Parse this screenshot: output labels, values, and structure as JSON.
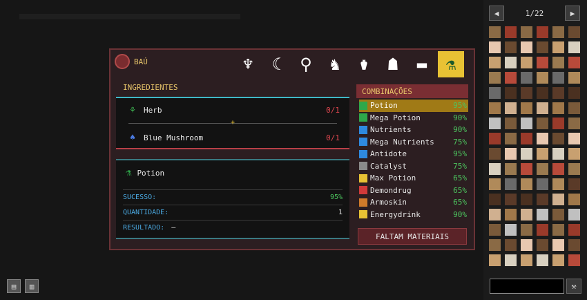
{
  "window": {
    "title": "BAÚ",
    "tabs": [
      "claws-icon",
      "crescent-icon",
      "totem-icon",
      "creature-icon",
      "lamp-icon",
      "face-icon",
      "anvil-icon",
      "potion-icon"
    ],
    "active_tab": 7
  },
  "ingredients": {
    "label": "INGREDIENTES",
    "plus": "+",
    "items": [
      {
        "name": "Herb",
        "qty": "0/1",
        "icon": "herb-icon"
      },
      {
        "name": "Blue Mushroom",
        "qty": "0/1",
        "icon": "mushroom-icon"
      }
    ]
  },
  "result": {
    "name": "Potion",
    "icon": "potion-icon",
    "rows": [
      {
        "key": "SUCESSO:",
        "value": "95%"
      },
      {
        "key": "QUANTIDADE:",
        "value": "1"
      },
      {
        "key": "RESULTADO:",
        "value": "—"
      }
    ]
  },
  "combos": {
    "label": "COMBINAÇÕES",
    "selected": 0,
    "items": [
      {
        "name": "Potion",
        "pct": "95%",
        "color": "#2ea84a"
      },
      {
        "name": "Mega Potion",
        "pct": "90%",
        "color": "#2ea84a"
      },
      {
        "name": "Nutrients",
        "pct": "90%",
        "color": "#2e8ae0"
      },
      {
        "name": "Mega Nutrients",
        "pct": "75%",
        "color": "#2e8ae0"
      },
      {
        "name": "Antidote",
        "pct": "95%",
        "color": "#2e8ae0"
      },
      {
        "name": "Catalyst",
        "pct": "75%",
        "color": "#8a8a8a"
      },
      {
        "name": "Max Potion",
        "pct": "65%",
        "color": "#e8c234"
      },
      {
        "name": "Demondrug",
        "pct": "65%",
        "color": "#d03a3a"
      },
      {
        "name": "Armoskin",
        "pct": "65%",
        "color": "#d07a2a"
      },
      {
        "name": "Energydrink",
        "pct": "90%",
        "color": "#e8c234"
      }
    ],
    "button": "FALTAM MATERIAIS"
  },
  "pager": {
    "prev": "◀",
    "label": "1/22",
    "next": "▶"
  },
  "inventory_colors": [
    "#8a6a45",
    "#9a7a50",
    "#a0784a",
    "#6a4a30",
    "#b08a5a",
    "#7a5a3a",
    "#c8a070",
    "#5a3a28",
    "#9a3a2a",
    "#b84a3a",
    "#d0b090",
    "#e8c8b0",
    "#6a6a6a",
    "#c0c0c0",
    "#d8d0c0",
    "#4a3020"
  ]
}
